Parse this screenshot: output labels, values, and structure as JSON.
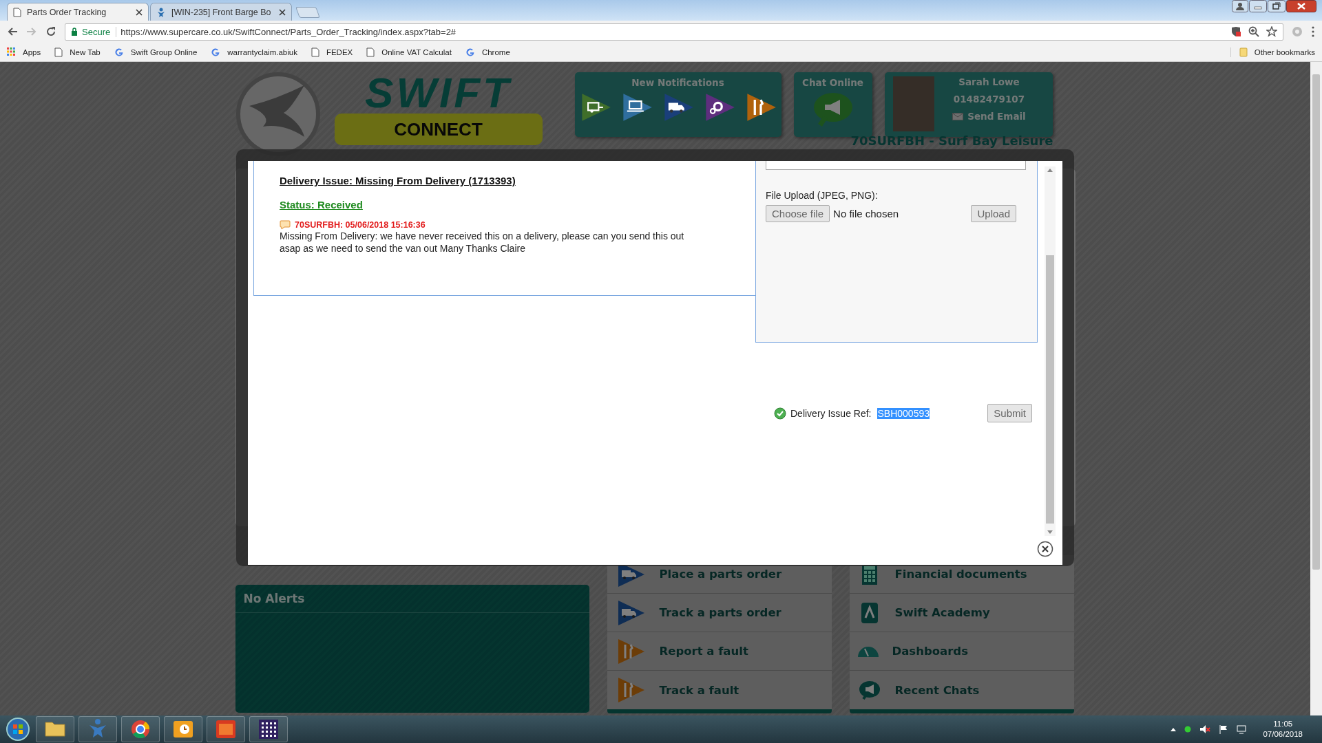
{
  "browser": {
    "tabs": [
      {
        "title": "Parts Order Tracking",
        "kind": "page",
        "selected": true
      },
      {
        "title": "[WIN-235] Front Barge Bo",
        "kind": "figure",
        "selected": false
      }
    ],
    "address": {
      "secure": "Secure",
      "url": "https://www.supercare.co.uk/SwiftConnect/Parts_Order_Tracking/index.aspx?tab=2#"
    },
    "bookmarks": [
      {
        "label": "Apps",
        "kind": "apps"
      },
      {
        "label": "New Tab",
        "kind": "page"
      },
      {
        "label": "Swift Group Online",
        "kind": "google"
      },
      {
        "label": "warrantyclaim.abiuk",
        "kind": "google"
      },
      {
        "label": "FEDEX",
        "kind": "page"
      },
      {
        "label": "Online VAT Calculat",
        "kind": "page"
      },
      {
        "label": "Chrome",
        "kind": "google"
      }
    ],
    "other_bookmarks": "Other bookmarks"
  },
  "header": {
    "brand": "SWIFT",
    "sub_brand": "CONNECT",
    "notifications": {
      "title": "New Notifications",
      "items": [
        {
          "kind": "caravan",
          "color": "#3f6e2a"
        },
        {
          "kind": "laptop",
          "color": "#2f6e9e"
        },
        {
          "kind": "truck",
          "color": "#1a3f7a"
        },
        {
          "kind": "gear",
          "color": "#5e2e7e"
        },
        {
          "kind": "tools",
          "color": "#b0620c"
        }
      ]
    },
    "chat": {
      "title": "Chat Online"
    },
    "contact": {
      "name": "Sarah Lowe",
      "phone": "01482479107",
      "email_link": "Send Email"
    }
  },
  "dealer": "70SURFBH - Surf Bay Leisure",
  "modal": {
    "title": "Delivery Issue: Missing From Delivery (1713393)",
    "status": "Status: Received",
    "comment": {
      "author_time": "70SURFBH: 05/06/2018 15:16:36",
      "text": "Missing From Delivery: we have never received this on a delivery, please can you send this out asap as we need to send the van out Many Thanks Claire"
    },
    "upload": {
      "label": "File Upload (JPEG, PNG):",
      "choose_button": "Choose file",
      "file_name": "No file chosen",
      "upload_button": "Upload"
    },
    "ref": {
      "label": "Delivery Issue Ref:",
      "value": "SBH000593"
    },
    "submit": "Submit"
  },
  "alerts": {
    "title": "No Alerts"
  },
  "menu_left": [
    {
      "label": "Place a parts order",
      "kind": "truck"
    },
    {
      "label": "Track a parts order",
      "kind": "truck"
    },
    {
      "label": "Report a fault",
      "kind": "tools"
    },
    {
      "label": "Track a fault",
      "kind": "tools"
    }
  ],
  "menu_right": [
    {
      "label": "Financial documents",
      "kind": "calculator"
    },
    {
      "label": "Swift Academy",
      "kind": "academy"
    },
    {
      "label": "Dashboards",
      "kind": "gauge"
    },
    {
      "label": "Recent Chats",
      "kind": "chat"
    }
  ],
  "taskbar": {
    "apps": [
      {
        "kind": "folder"
      },
      {
        "kind": "figure"
      },
      {
        "kind": "chrome"
      },
      {
        "kind": "mail"
      },
      {
        "kind": "red-app"
      },
      {
        "kind": "grid"
      }
    ],
    "time": "11:05",
    "date": "07/06/2018"
  }
}
